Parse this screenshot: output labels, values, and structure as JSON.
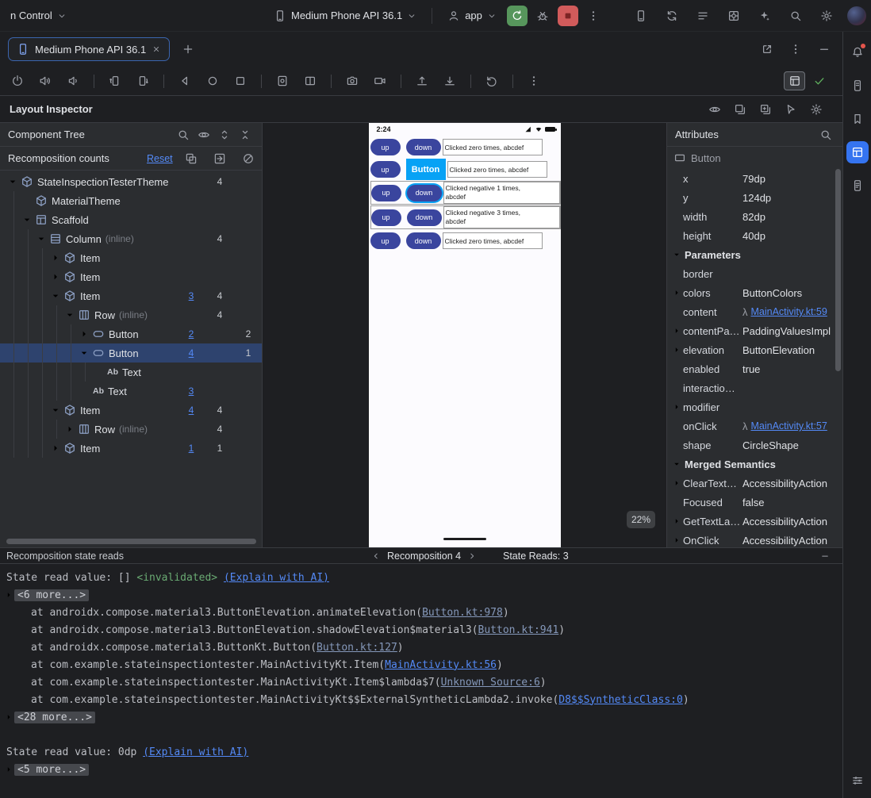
{
  "colors": {
    "accent": "#3574f0",
    "link": "#548af7",
    "selection_row": "#2e436e",
    "invalidated_green": "#6aab73",
    "device_button": "#3a459e",
    "selection_overlay": "#08a2f5",
    "run_green": "#57965c",
    "stop_red": "#d15b5b",
    "panel_bg": "#2b2d30",
    "window_bg": "#1e1f22",
    "border": "#393b40",
    "text": "#dfe1e5",
    "muted_text": "#9da0a8",
    "fold_bg": "#46484d"
  },
  "titlebar": {
    "vcs": "n Control",
    "device": "Medium Phone API 36.1",
    "run_config": "app",
    "right_tools": [
      "device-manager",
      "sync",
      "structure",
      "app-inspection",
      "ai-chat",
      "search",
      "settings"
    ]
  },
  "tab_bar": {
    "tab": "Medium Phone API 36.1"
  },
  "emulator_toolbar": {
    "groups": [
      [
        "power",
        "volume-up",
        "volume-down"
      ],
      [
        "rotate-left",
        "rotate-right"
      ],
      [
        "back",
        "home",
        "overview"
      ],
      [
        "screenshot",
        "fold"
      ],
      [
        "camera",
        "video"
      ],
      [
        "upload",
        "download"
      ],
      [
        "undo"
      ],
      [
        "kebab"
      ]
    ],
    "right_toggle": "frame",
    "ready_check": "check"
  },
  "inspector": {
    "title": "Layout Inspector",
    "tools": [
      "eye",
      "layers",
      "layers-add",
      "cursor",
      "gear"
    ]
  },
  "tree": {
    "title": "Component Tree",
    "tools": [
      "search",
      "eye",
      "expand-all",
      "collapse-all"
    ],
    "counts_label": "Recomposition counts",
    "reset_label": "Reset",
    "header_tools": [
      "counts",
      "skips",
      "slash"
    ],
    "rows": [
      {
        "label": "StateInspectionTesterTheme",
        "icon": "cube",
        "depth": 0,
        "chevron": "down",
        "c2": "4"
      },
      {
        "label": "MaterialTheme",
        "icon": "cube",
        "depth": 1,
        "chevron": "none"
      },
      {
        "label": "Scaffold",
        "icon": "scaffold",
        "depth": 1,
        "chevron": "down"
      },
      {
        "label": "Column",
        "suffix": "(inline)",
        "icon": "column",
        "depth": 2,
        "chevron": "down",
        "c2": "4"
      },
      {
        "label": "Item",
        "icon": "cube",
        "depth": 3,
        "chevron": "right"
      },
      {
        "label": "Item",
        "icon": "cube",
        "depth": 3,
        "chevron": "right"
      },
      {
        "label": "Item",
        "icon": "cube",
        "depth": 3,
        "chevron": "down",
        "c1": "3",
        "c2": "4"
      },
      {
        "label": "Row",
        "suffix": "(inline)",
        "icon": "row",
        "depth": 4,
        "chevron": "down",
        "c2": "4"
      },
      {
        "label": "Button",
        "icon": "button",
        "depth": 5,
        "chevron": "right",
        "c1": "2",
        "c3": "2"
      },
      {
        "label": "Button",
        "icon": "button",
        "depth": 5,
        "chevron": "down",
        "c1": "4",
        "c3": "1",
        "selected": true
      },
      {
        "label": "Text",
        "icon": "text",
        "depth": 6,
        "chevron": "none"
      },
      {
        "label": "Text",
        "icon": "text",
        "depth": 5,
        "chevron": "none",
        "c1": "3"
      },
      {
        "label": "Item",
        "icon": "cube",
        "depth": 3,
        "chevron": "down",
        "c1": "4",
        "c2": "4"
      },
      {
        "label": "Row",
        "suffix": "(inline)",
        "icon": "row",
        "depth": 4,
        "chevron": "right",
        "c2": "4"
      },
      {
        "label": "Item",
        "icon": "cube",
        "depth": 3,
        "chevron": "right",
        "c1": "1",
        "c2": "1"
      }
    ]
  },
  "device": {
    "time": "2:24",
    "zoom": "22%",
    "selection_label": "Button",
    "button_up": "up",
    "button_down": "down",
    "rows": [
      {
        "text": "Clicked zero times, abcdef",
        "variant": "plain"
      },
      {
        "text": "Clicked zero times, abcdef",
        "variant": "selected"
      },
      {
        "text": "Clicked negative 1 times, abcdef",
        "variant": "boxed-hover"
      },
      {
        "text": "Clicked negative 3 times, abcdef",
        "variant": "boxed"
      },
      {
        "text": "Clicked zero times, abcdef",
        "variant": "plain"
      }
    ]
  },
  "attributes": {
    "title": "Attributes",
    "component": "Button",
    "rows": [
      {
        "type": "attr",
        "key": "x",
        "value": "79dp"
      },
      {
        "type": "attr",
        "key": "y",
        "value": "124dp"
      },
      {
        "type": "attr",
        "key": "width",
        "value": "82dp"
      },
      {
        "type": "attr",
        "key": "height",
        "value": "40dp"
      },
      {
        "type": "section",
        "label": "Parameters"
      },
      {
        "type": "attr",
        "key": "border",
        "value": ""
      },
      {
        "type": "attr",
        "key": "colors",
        "value": "ButtonColors",
        "expandable": true
      },
      {
        "type": "attr",
        "key": "content",
        "lambda": true,
        "link": "MainActivity.kt:59"
      },
      {
        "type": "attr",
        "key": "contentPa…",
        "value": "PaddingValuesImpl",
        "expandable": true
      },
      {
        "type": "attr",
        "key": "elevation",
        "value": "ButtonElevation",
        "expandable": true
      },
      {
        "type": "attr",
        "key": "enabled",
        "value": "true"
      },
      {
        "type": "attr",
        "key": "interactio…",
        "value": ""
      },
      {
        "type": "attr",
        "key": "modifier",
        "value": "",
        "expandable": true
      },
      {
        "type": "attr",
        "key": "onClick",
        "lambda": true,
        "link": "MainActivity.kt:57"
      },
      {
        "type": "attr",
        "key": "shape",
        "value": "CircleShape"
      },
      {
        "type": "section",
        "label": "Merged Semantics"
      },
      {
        "type": "attr",
        "key": "ClearText…",
        "value": "AccessibilityAction",
        "expandable": true
      },
      {
        "type": "attr",
        "key": "Focused",
        "value": "false"
      },
      {
        "type": "attr",
        "key": "GetTextLa…",
        "value": "AccessibilityAction",
        "expandable": true
      },
      {
        "type": "attr",
        "key": "OnClick",
        "value": "AccessibilityAction",
        "expandable": true
      }
    ]
  },
  "state_reads": {
    "title": "Recomposition state reads",
    "nav": "Recomposition 4",
    "count_label": "State Reads: 3",
    "lines": [
      {
        "type": "value",
        "text": "State read value: [] ",
        "tag": "<invalidated>",
        "link": "(Explain with AI)"
      },
      {
        "type": "fold",
        "text": "<6 more...>"
      },
      {
        "type": "frame",
        "text": "at androidx.compose.material3.ButtonElevation.animateElevation(",
        "link": "Button.kt:978",
        "suffix": ")",
        "bright": false
      },
      {
        "type": "frame",
        "text": "at androidx.compose.material3.ButtonElevation.shadowElevation$material3(",
        "link": "Button.kt:941",
        "suffix": ")",
        "bright": false
      },
      {
        "type": "frame",
        "text": "at androidx.compose.material3.ButtonKt.Button(",
        "link": "Button.kt:127",
        "suffix": ")",
        "bright": false
      },
      {
        "type": "frame",
        "text": "at com.example.stateinspectiontester.MainActivityKt.Item(",
        "link": "MainActivity.kt:56",
        "suffix": ")",
        "bright": true
      },
      {
        "type": "frame",
        "text": "at com.example.stateinspectiontester.MainActivityKt.Item$lambda$7(",
        "link": "Unknown Source:6",
        "suffix": ")",
        "bright": false
      },
      {
        "type": "frame",
        "text": "at com.example.stateinspectiontester.MainActivityKt$$ExternalSyntheticLambda2.invoke(",
        "link": "D8$$SyntheticClass:0",
        "suffix": ")",
        "bright": true
      },
      {
        "type": "fold",
        "text": "<28 more...>"
      },
      {
        "type": "blank"
      },
      {
        "type": "value",
        "text": "State read value: 0dp ",
        "tag": "",
        "link": "(Explain with AI)"
      },
      {
        "type": "fold",
        "text": "<5 more...>"
      }
    ]
  },
  "stripe": {
    "top": [
      {
        "icon": "notifications",
        "badge": true
      },
      {
        "icon": "device-explorer"
      },
      {
        "icon": "bookmarks"
      },
      {
        "icon": "layout-inspector",
        "active": true
      },
      {
        "icon": "logcat"
      }
    ],
    "bottom": [
      "sliders"
    ]
  }
}
